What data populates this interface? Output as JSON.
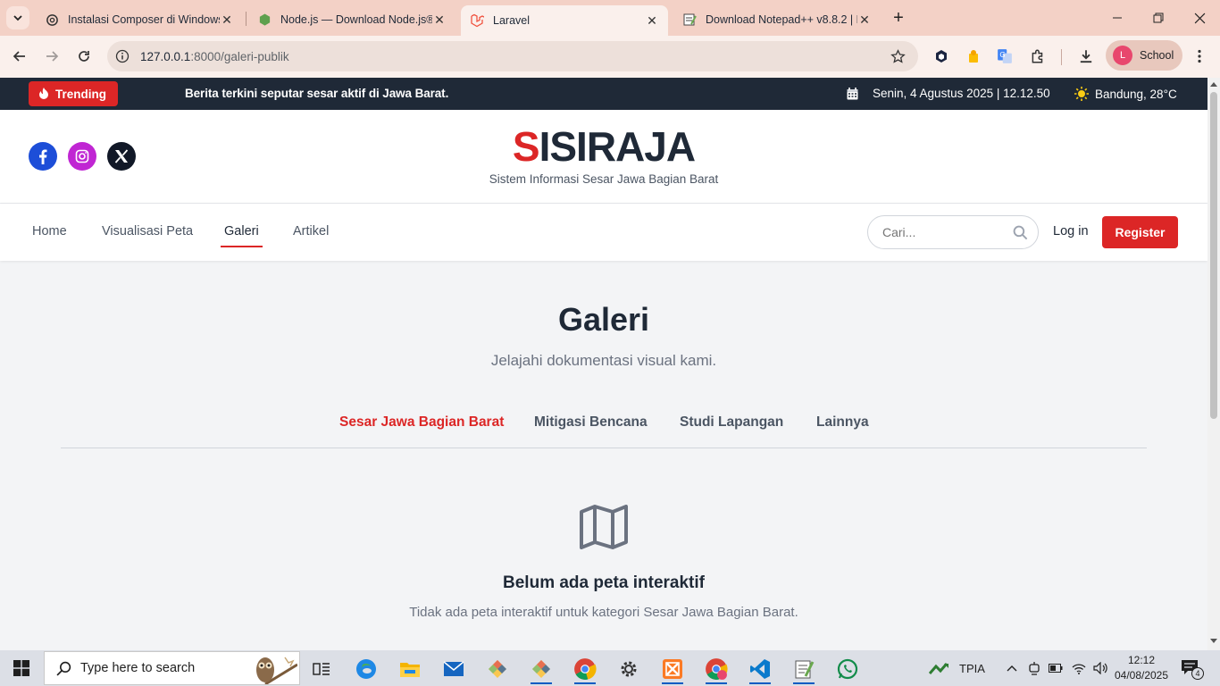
{
  "browser": {
    "tabs": [
      {
        "title": "Instalasi Composer di Windows",
        "icon": "openai-icon",
        "active": false
      },
      {
        "title": "Node.js — Download Node.js®",
        "icon": "nodejs-icon",
        "active": false
      },
      {
        "title": "Laravel",
        "icon": "laravel-icon",
        "active": true
      },
      {
        "title": "Download Notepad++ v8.8.2 | N",
        "icon": "notepadpp-icon",
        "active": false
      }
    ],
    "url_host": "127.0.0.1",
    "url_path": ":8000/galeri-publik",
    "profile_initial": "L",
    "profile_name": "School"
  },
  "site": {
    "trending_label": "Trending",
    "ticker_text": "Berita terkini seputar sesar aktif di Jawa Barat.",
    "datetime": "Senin, 4 Agustus 2025 | 12.12.50",
    "weather": "Bandung, 28°C",
    "logo_first": "S",
    "logo_rest": "ISIRAJA",
    "tagline": "Sistem Informasi Sesar Jawa Bagian Barat",
    "nav": [
      "Home",
      "Visualisasi Peta",
      "Galeri",
      "Artikel"
    ],
    "active_nav": "Galeri",
    "search_placeholder": "Cari...",
    "login_label": "Log in",
    "register_label": "Register"
  },
  "main": {
    "title": "Galeri",
    "subtitle": "Jelajahi dokumentasi visual kami.",
    "categories": [
      "Sesar Jawa Bagian Barat",
      "Mitigasi Bencana",
      "Studi Lapangan",
      "Lainnya"
    ],
    "active_category": "Sesar Jawa Bagian Barat",
    "empty_title": "Belum ada peta interaktif",
    "empty_desc": "Tidak ada peta interaktif untuk kategori Sesar Jawa Bagian Barat."
  },
  "taskbar": {
    "search_placeholder": "Type here to search",
    "tray_label": "TPIA",
    "time": "12:12",
    "date": "04/08/2025",
    "notification_count": "4"
  },
  "colors": {
    "accent": "#dc2626",
    "topbar": "#1f2937",
    "chrome": "#f3d1c6"
  }
}
